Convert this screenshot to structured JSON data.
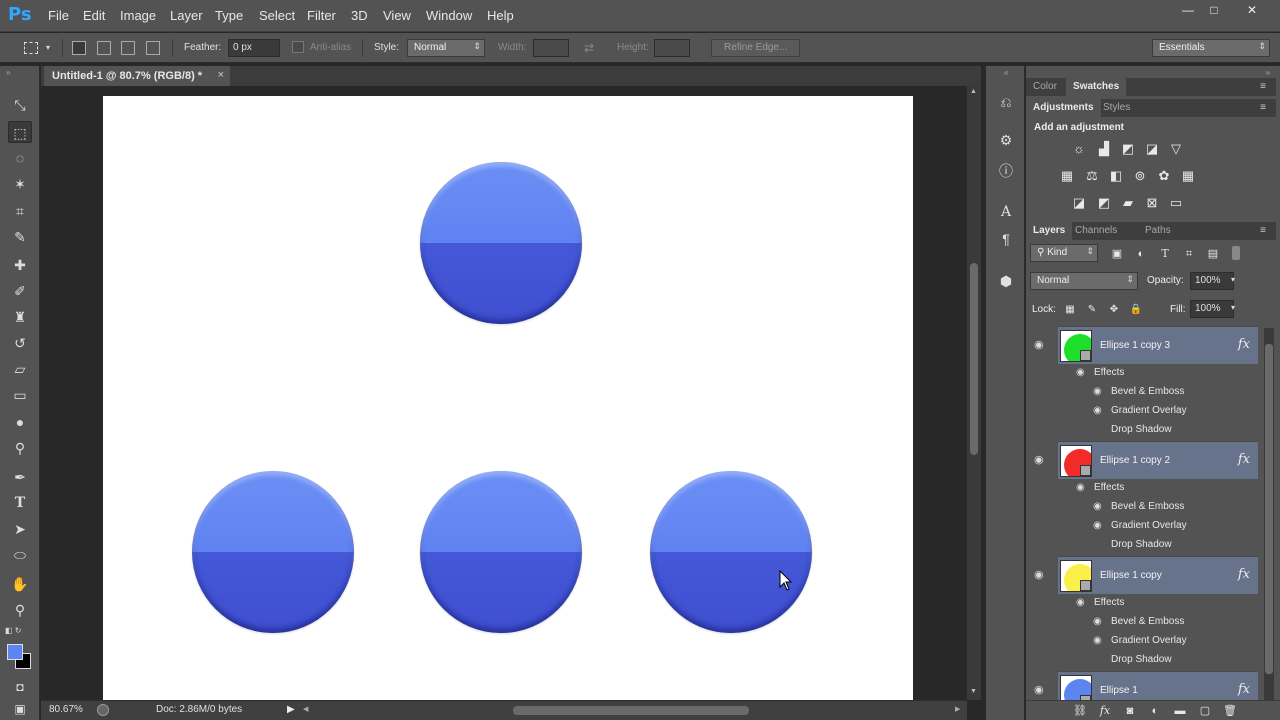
{
  "app": {
    "logo": "Ps"
  },
  "menu": [
    "File",
    "Edit",
    "Image",
    "Layer",
    "Type",
    "Select",
    "Filter",
    "3D",
    "View",
    "Window",
    "Help"
  ],
  "window_controls": {
    "minimize": "—",
    "maximize": "□",
    "close": "✕"
  },
  "options": {
    "feather_label": "Feather:",
    "feather_value": "0 px",
    "antialias_label": "Anti-alias",
    "style_label": "Style:",
    "style_value": "Normal",
    "width_label": "Width:",
    "height_label": "Height:",
    "refine_edge": "Refine Edge...",
    "workspace": "Essentials"
  },
  "document": {
    "tab_title": "Untitled-1 @ 80.7% (RGB/8) *",
    "close": "×",
    "zoom": "80.67%",
    "doc_info": "Doc: 2.86M/0 bytes",
    "ball_colors": {
      "top": "#6b8ff5",
      "bottom": "#3f4fd0"
    }
  },
  "panels": {
    "top_tabs": [
      "Color",
      "Swatches"
    ],
    "adj_tabs": [
      "Adjustments",
      "Styles"
    ],
    "adj_title": "Add an adjustment",
    "adj_icons_row1": [
      "brightness-icon",
      "levels-icon",
      "curves-icon",
      "exposure-icon",
      "vibrance-icon"
    ],
    "adj_icons_row2": [
      "hue-sat-icon",
      "color-balance-icon",
      "bw-icon",
      "photo-filter-icon",
      "channel-mixer-icon",
      "color-lookup-icon"
    ],
    "adj_icons_row3": [
      "invert-icon",
      "posterize-icon",
      "threshold-icon",
      "selective-color-icon",
      "gradient-map-icon"
    ],
    "layer_tabs": [
      "Layers",
      "Channels",
      "Paths"
    ],
    "kind_label": "Kind",
    "blend_mode": "Normal",
    "opacity_label": "Opacity:",
    "opacity_value": "100%",
    "lock_label": "Lock:",
    "fill_label": "Fill:",
    "fill_value": "100%",
    "effects_label": "Effects",
    "layers": [
      {
        "name": "Ellipse 1 copy 3",
        "color": "#1ee02a",
        "effects": [
          "Bevel & Emboss",
          "Gradient Overlay",
          "Drop Shadow"
        ]
      },
      {
        "name": "Ellipse 1 copy 2",
        "color": "#f32a2a",
        "effects": [
          "Bevel & Emboss",
          "Gradient Overlay",
          "Drop Shadow"
        ]
      },
      {
        "name": "Ellipse 1 copy",
        "color": "#fbf04a",
        "effects": [
          "Bevel & Emboss",
          "Gradient Overlay",
          "Drop Shadow"
        ]
      },
      {
        "name": "Ellipse 1",
        "color": "#5b86f2",
        "effects": []
      }
    ],
    "fx": "fx"
  }
}
